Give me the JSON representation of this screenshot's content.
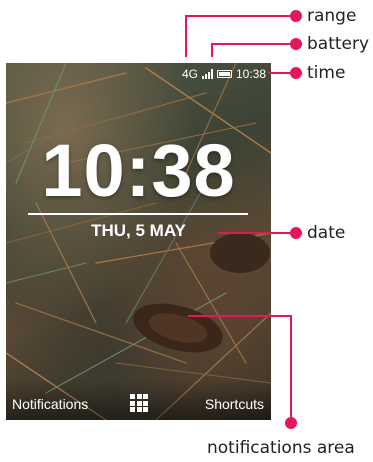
{
  "phone": {
    "status_bar": {
      "network": "4G",
      "time": "10:38",
      "icons": [
        "signal-bars-icon",
        "battery-icon"
      ]
    },
    "clock": "10:38",
    "date": "THU, 5 MAY",
    "softkeys": {
      "left": "Notifications",
      "center_icon": "app-grid-icon",
      "right": "Shortcuts"
    }
  },
  "callouts": {
    "range": "range",
    "battery": "battery",
    "time": "time",
    "date": "date",
    "notifications_area": "notifications area"
  },
  "colors": {
    "accent": "#e5175b",
    "label_text": "#222222",
    "screen_text": "#ffffff"
  }
}
